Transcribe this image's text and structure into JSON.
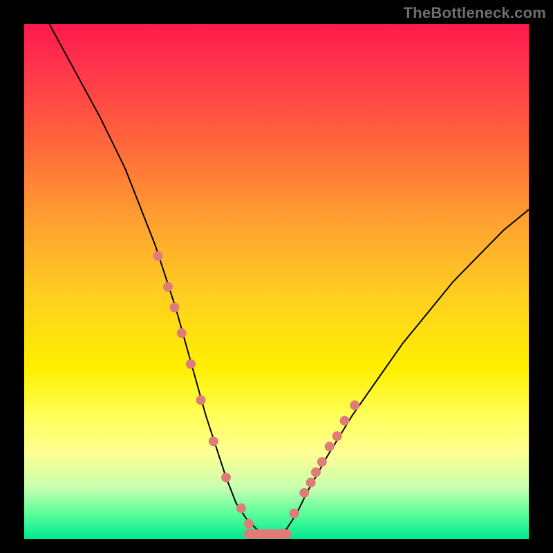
{
  "attribution": "TheBottleneck.com",
  "chart_data": {
    "type": "line",
    "title": "",
    "xlabel": "",
    "ylabel": "",
    "xlim": [
      0,
      100
    ],
    "ylim": [
      0,
      100
    ],
    "series": [
      {
        "name": "bottleneck-curve",
        "x": [
          5,
          10,
          15,
          20,
          22,
          24,
          26,
          28,
          30,
          32,
          34,
          36,
          38,
          40,
          42,
          44,
          46,
          48,
          50,
          52,
          54,
          56,
          60,
          65,
          70,
          75,
          80,
          85,
          90,
          95,
          100
        ],
        "y": [
          100,
          91,
          82,
          72,
          67,
          62,
          57,
          51,
          45,
          38,
          31,
          24,
          18,
          12,
          7,
          4,
          2,
          1,
          1,
          2,
          5,
          9,
          16,
          24,
          31,
          38,
          44,
          50,
          55,
          60,
          64
        ]
      }
    ],
    "markers": {
      "name": "highlight-points",
      "color": "#e07c78",
      "radius_px": 7,
      "x": [
        26.5,
        28.5,
        29.8,
        31.2,
        33.0,
        35.0,
        37.5,
        40.0,
        43.0,
        44.5,
        48.5,
        53.5,
        55.5,
        56.8,
        57.8,
        59.0,
        60.5,
        62.0,
        63.5,
        65.5
      ],
      "y": [
        55,
        49,
        45,
        40,
        34,
        27,
        19,
        12,
        6,
        3,
        1,
        5,
        9,
        11,
        13,
        15,
        18,
        20,
        23,
        26
      ]
    },
    "flat_segment": {
      "name": "bottom-plateau",
      "color": "#e07c78",
      "x_start": 44.5,
      "x_end": 52.0,
      "y": 1
    },
    "background_gradient": {
      "top": "#ff1a4d",
      "middle": "#ffd020",
      "bottom": "#00e890"
    }
  }
}
